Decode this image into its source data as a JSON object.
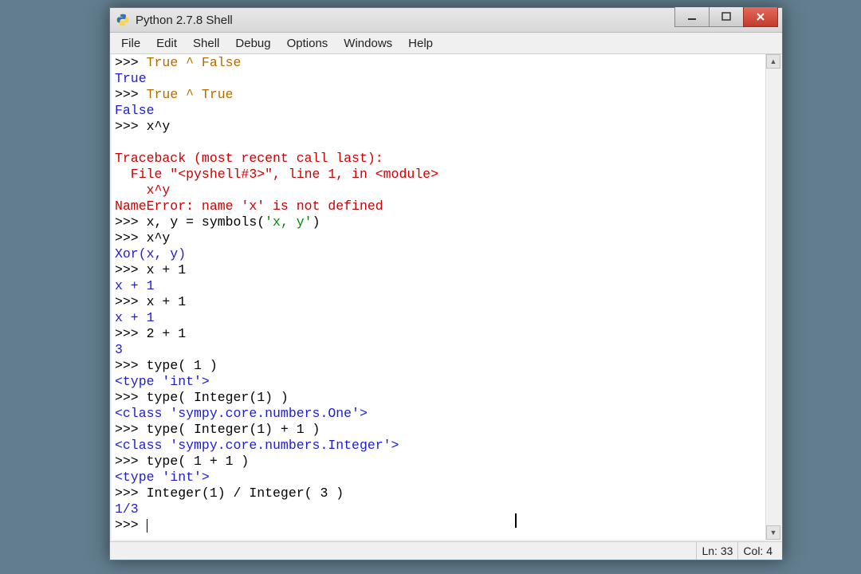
{
  "window": {
    "title": "Python 2.7.8 Shell"
  },
  "menu": {
    "file": "File",
    "edit": "Edit",
    "shell": "Shell",
    "debug": "Debug",
    "options": "Options",
    "windows": "Windows",
    "help": "Help"
  },
  "shell": {
    "prompt": ">>> ",
    "lines": [
      {
        "text": "True ^ False",
        "kind": "input_kw"
      },
      {
        "text": "True",
        "kind": "out"
      },
      {
        "text": "True ^ True",
        "kind": "input_kw"
      },
      {
        "text": "False",
        "kind": "out"
      },
      {
        "text": "x^y",
        "kind": "input"
      },
      {
        "text": "",
        "kind": "blank"
      },
      {
        "text": "Traceback (most recent call last):",
        "kind": "err"
      },
      {
        "text": "  File \"<pyshell#3>\", line 1, in <module>",
        "kind": "err"
      },
      {
        "text": "    x^y",
        "kind": "err"
      },
      {
        "text": "NameError: name 'x' is not defined",
        "kind": "err"
      },
      {
        "text": "x, y = symbols('x, y')",
        "kind": "input_assign"
      },
      {
        "text": "x^y",
        "kind": "input"
      },
      {
        "text": "Xor(x, y)",
        "kind": "out"
      },
      {
        "text": "x + 1",
        "kind": "input"
      },
      {
        "text": "x + 1",
        "kind": "out"
      },
      {
        "text": "x + 1",
        "kind": "input"
      },
      {
        "text": "x + 1",
        "kind": "out"
      },
      {
        "text": "2 + 1",
        "kind": "input"
      },
      {
        "text": "3",
        "kind": "out"
      },
      {
        "text": "type( 1 )",
        "kind": "input"
      },
      {
        "text": "<type 'int'>",
        "kind": "out"
      },
      {
        "text": "type( Integer(1) )",
        "kind": "input"
      },
      {
        "text": "<class 'sympy.core.numbers.One'>",
        "kind": "out"
      },
      {
        "text": "type( Integer(1) + 1 )",
        "kind": "input"
      },
      {
        "text": "<class 'sympy.core.numbers.Integer'>",
        "kind": "out"
      },
      {
        "text": "type( 1 + 1 )",
        "kind": "input"
      },
      {
        "text": "<type 'int'>",
        "kind": "out"
      },
      {
        "text": "Integer(1) / Integer( 3 )",
        "kind": "input"
      },
      {
        "text": "1/3",
        "kind": "out"
      },
      {
        "text": "",
        "kind": "input_cursor"
      }
    ]
  },
  "status": {
    "line": "Ln: 33",
    "col": "Col: 4"
  }
}
